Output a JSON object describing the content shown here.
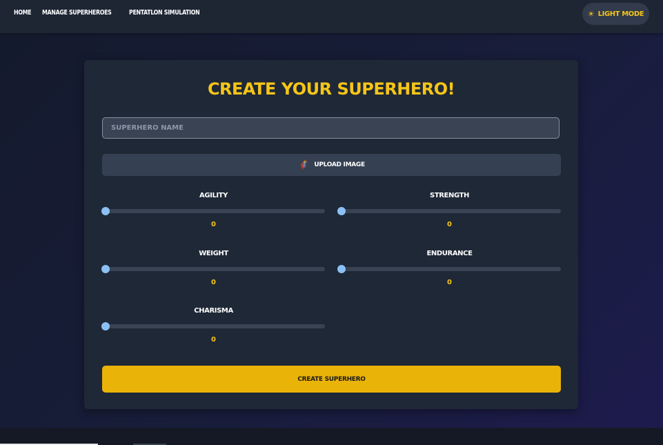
{
  "nav": {
    "links": [
      {
        "label": "HOME"
      },
      {
        "label": "MANAGE SUPERHEROES"
      },
      {
        "label": "PENTATLON SIMULATION"
      }
    ],
    "theme_toggle": {
      "icon": "sun-icon",
      "label": "LIGHT MODE"
    }
  },
  "form": {
    "title": "CREATE YOUR SUPERHERO!",
    "name_placeholder": "SUPERHERO NAME",
    "name_value": "",
    "upload": {
      "icon": "superhero-icon",
      "label": "UPLOAD IMAGE"
    },
    "stats": [
      {
        "label": "AGILITY",
        "value": "0",
        "level": 0
      },
      {
        "label": "STRENGTH",
        "value": "0",
        "level": 0
      },
      {
        "label": "WEIGHT",
        "value": "0",
        "level": 0
      },
      {
        "label": "ENDURANCE",
        "value": "0",
        "level": 0
      },
      {
        "label": "CHARISMA",
        "value": "0",
        "level": 0
      }
    ],
    "submit_label": "CREATE SUPERHERO"
  },
  "colors": {
    "accent": "#f5c518",
    "button": "#eab308",
    "card": "#1f2836",
    "navbar": "#1e2634",
    "slider_thumb": "#8cc0f5"
  }
}
